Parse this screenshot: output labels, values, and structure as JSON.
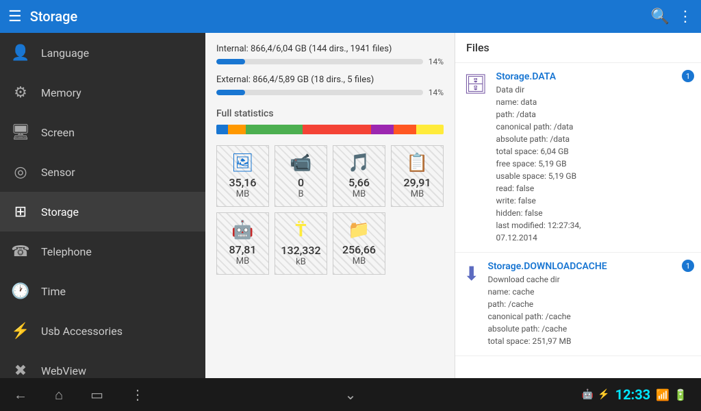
{
  "topBar": {
    "title": "Storage",
    "menuIcon": "☰",
    "searchIcon": "🔍",
    "moreIcon": "⋮"
  },
  "sidebar": {
    "items": [
      {
        "id": "language",
        "label": "Language",
        "icon": "👤"
      },
      {
        "id": "memory",
        "label": "Memory",
        "icon": "⚙"
      },
      {
        "id": "screen",
        "label": "Screen",
        "icon": "🖥"
      },
      {
        "id": "sensor",
        "label": "Sensor",
        "icon": "◎"
      },
      {
        "id": "storage",
        "label": "Storage",
        "icon": "⊞",
        "active": true
      },
      {
        "id": "telephone",
        "label": "Telephone",
        "icon": "☎"
      },
      {
        "id": "time",
        "label": "Time",
        "icon": "🕐"
      },
      {
        "id": "usb",
        "label": "Usb Accessories",
        "icon": "⚡"
      },
      {
        "id": "webview",
        "label": "WebView",
        "icon": "✖"
      }
    ]
  },
  "storage": {
    "internalLabel": "Internal: 866,4/6,04 GB (144 dirs., 1941 files)",
    "internalPercent": 14,
    "internalPercentLabel": "14%",
    "externalLabel": "External: 866,4/5,89 GB (18 dirs., 5 files)",
    "externalPercent": 14,
    "externalPercentLabel": "14%",
    "fullStatsLabel": "Full statistics",
    "statsBar": [
      {
        "color": "#1976D2",
        "width": 5
      },
      {
        "color": "#FF9800",
        "width": 8
      },
      {
        "color": "#4CAF50",
        "width": 25
      },
      {
        "color": "#F44336",
        "width": 30
      },
      {
        "color": "#9C27B0",
        "width": 10
      },
      {
        "color": "#FF5722",
        "width": 10
      },
      {
        "color": "#FFEB3B",
        "width": 12
      }
    ],
    "stats": [
      {
        "icon": "🖼",
        "value": "35,16",
        "unit": "MB",
        "iconColor": "#1976D2"
      },
      {
        "icon": "📹",
        "value": "0",
        "unit": "B",
        "iconColor": "#9C27B0"
      },
      {
        "icon": "🎵",
        "value": "5,66",
        "unit": "MB",
        "iconColor": "#4CAF50"
      },
      {
        "icon": "📋",
        "value": "29,91",
        "unit": "MB",
        "iconColor": "#FF9800"
      },
      {
        "icon": "🤖",
        "value": "87,81",
        "unit": "MB",
        "iconColor": "#8BC34A"
      },
      {
        "icon": "T",
        "value": "132,332",
        "unit": "kB",
        "iconColor": "#FFEB3B"
      },
      {
        "icon": "📁",
        "value": "256,66",
        "unit": "MB",
        "iconColor": "#F44336"
      }
    ]
  },
  "files": {
    "header": "Files",
    "items": [
      {
        "id": "data",
        "icon": "🗄",
        "title": "Storage.DATA",
        "badge": "1",
        "description": "Data dir\nname: data\npath: /data\ncanonical path: /data\nabsolute path: /data\ntotal space: 6,04 GB\nfree space: 5,19 GB\nusable space: 5,19 GB\nread: false\nwrite: false\nhidden: false\nlast modified: 12:27:34,\n07.12.2014"
      },
      {
        "id": "downloadcache",
        "icon": "⬇",
        "title": "Storage.DOWNLOADCACHE",
        "badge": "1",
        "description": "Download cache dir\nname: cache\npath: /cache\ncanonical path: /cache\nabsolute path: /cache\ntotal space: 251,97 MB"
      }
    ]
  },
  "bottomNav": {
    "backIcon": "←",
    "homeIcon": "⌂",
    "recentIcon": "▭",
    "moreIcon": "⋮",
    "downIcon": "⌄",
    "time": "12:33",
    "batteryIcon": "🔋",
    "signalIcon": "📶"
  }
}
